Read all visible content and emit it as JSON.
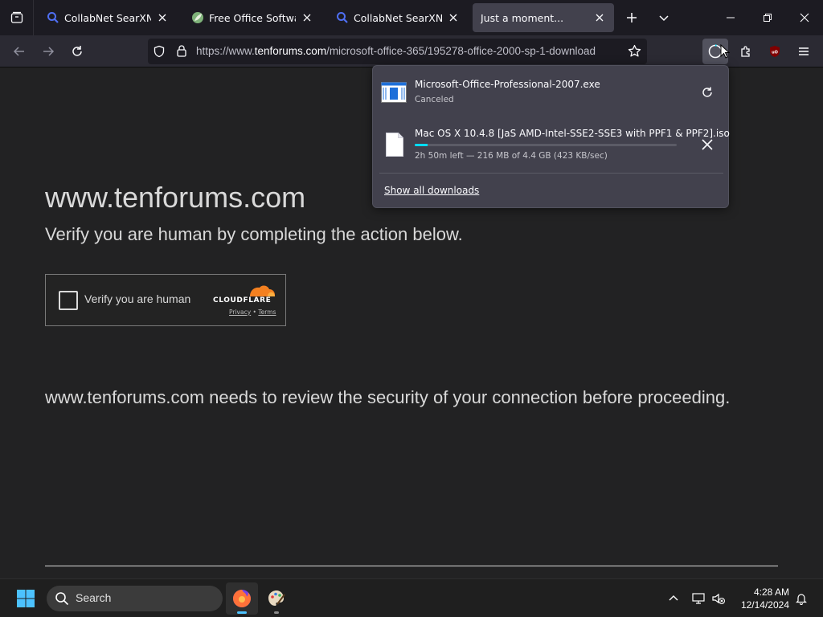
{
  "tabs": [
    {
      "title": "CollabNet SearXNG",
      "icon": "search-icon"
    },
    {
      "title": "Free Office Software - I",
      "icon": "leaf-icon"
    },
    {
      "title": "CollabNet SearXNG",
      "icon": "search-icon"
    },
    {
      "title": "Just a moment...",
      "icon": "none",
      "active": true
    }
  ],
  "urlbar": {
    "url_prefix": "https://www.",
    "url_domain": "tenforums.com",
    "url_path": "/microsoft-office-365/195278-office-2000-sp-1-download"
  },
  "page": {
    "site_title": "www.tenforums.com",
    "subtitle": "Verify you are human by completing the action below.",
    "captcha_label": "Verify you are human",
    "cloudflare_brand": "CLOUDFLARE",
    "privacy_link": "Privacy",
    "link_separator": "•",
    "terms_link": "Terms",
    "review_text": "www.tenforums.com needs to review the security of your connection before proceeding."
  },
  "downloads": {
    "items": [
      {
        "name": "Microsoft-Office-Professional-2007.exe",
        "status": "Canceled",
        "action": "retry-icon"
      },
      {
        "name": "Mac OS X 10.4.8 [JaS AMD-Intel-SSE2-SSE3 with PPF1 & PPF2].iso",
        "status": "2h 50m left — 216 MB of 4.4 GB (423 KB/sec)",
        "progress": 0.05,
        "action": "cancel-icon"
      }
    ],
    "show_all": "Show all downloads"
  },
  "taskbar": {
    "search_label": "Search",
    "time": "4:28 AM",
    "date": "12/14/2024"
  },
  "colors": {
    "accent": "#00ddff",
    "page_bg": "#222223",
    "chrome_bg": "#2b2a33"
  }
}
